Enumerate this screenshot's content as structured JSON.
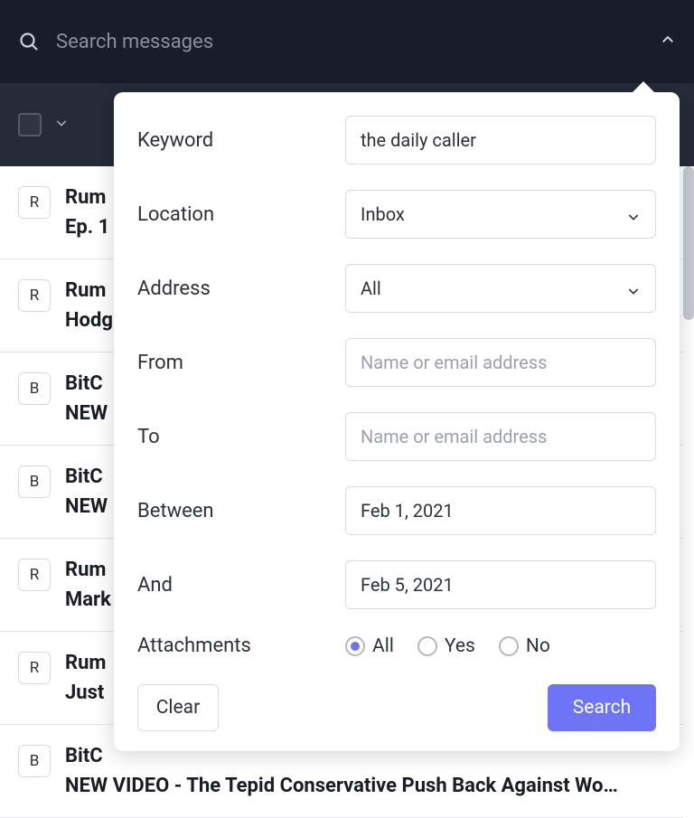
{
  "search": {
    "placeholder": "Search messages"
  },
  "panel": {
    "labels": {
      "keyword": "Keyword",
      "location": "Location",
      "address": "Address",
      "from": "From",
      "to": "To",
      "between": "Between",
      "and": "And",
      "attachments": "Attachments"
    },
    "values": {
      "keyword": "the daily caller",
      "location": "Inbox",
      "address": "All",
      "from_placeholder": "Name or email address",
      "to_placeholder": "Name or email address",
      "between": "Feb 1, 2021",
      "and": "Feb 5, 2021"
    },
    "attachments": {
      "options": [
        "All",
        "Yes",
        "No"
      ],
      "selected": "All"
    },
    "buttons": {
      "clear": "Clear",
      "search": "Search"
    }
  },
  "messages": [
    {
      "initial": "R",
      "line1": "Rum",
      "line2": "Ep. 1"
    },
    {
      "initial": "R",
      "line1": "Rum",
      "line2": "Hodg"
    },
    {
      "initial": "B",
      "line1": "BitC",
      "line2": "NEW"
    },
    {
      "initial": "B",
      "line1": "BitC",
      "line2": "NEW"
    },
    {
      "initial": "R",
      "line1": "Rum",
      "line2": "Mark"
    },
    {
      "initial": "R",
      "line1": "Rum",
      "line2": "Just"
    },
    {
      "initial": "B",
      "line1": "BitC",
      "line2": "NEW VIDEO - The Tepid Conservative Push Back Against Wo…"
    }
  ]
}
